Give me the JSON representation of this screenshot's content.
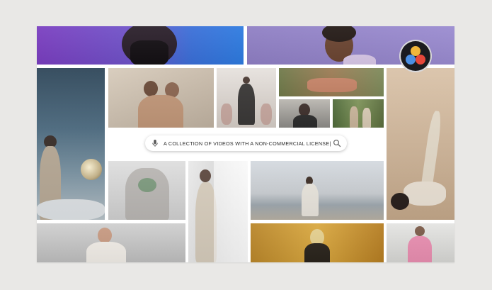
{
  "search": {
    "text": "A COLLECTION OF VIDEOS WITH A NON-COMMERCIAL LICENSE|",
    "mic_icon": "microphone-icon",
    "search_icon": "magnifier-icon"
  },
  "logo": {
    "icon": "davinci-resolve-logo-icon",
    "colors": [
      "#e6473a",
      "#f0b63b",
      "#4b8fe3"
    ]
  },
  "colors": {
    "background": "#e9e8e6",
    "frame": "#ffffff"
  }
}
